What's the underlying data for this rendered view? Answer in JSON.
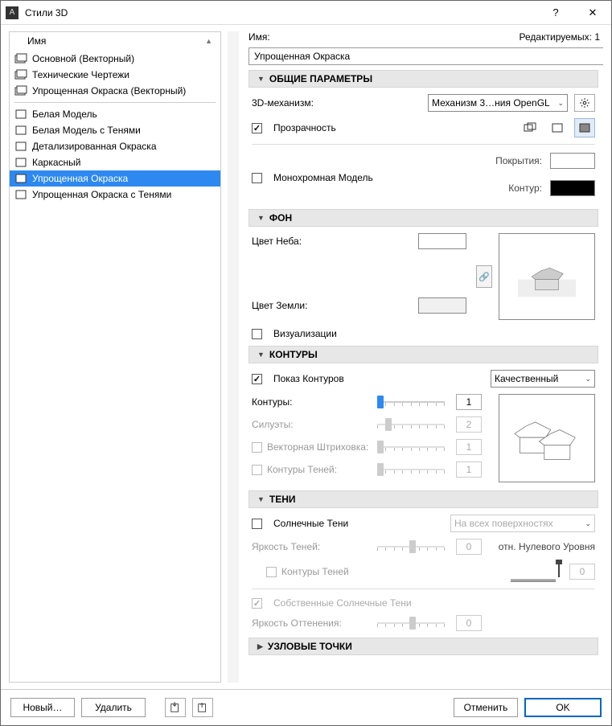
{
  "window": {
    "title": "Стили 3D"
  },
  "left": {
    "header": "Имя",
    "groups": [
      {
        "items": [
          {
            "label": "Основной (Векторный)"
          },
          {
            "label": "Технические Чертежи"
          },
          {
            "label": "Упрощенная Окраска (Векторный)"
          }
        ]
      },
      {
        "items": [
          {
            "label": "Белая Модель"
          },
          {
            "label": "Белая Модель с Тенями"
          },
          {
            "label": "Детализированная Окраска"
          },
          {
            "label": "Каркасный"
          },
          {
            "label": "Упрощенная Окраска",
            "selected": true
          },
          {
            "label": "Упрощенная Окраска с Тенями"
          }
        ]
      }
    ]
  },
  "right": {
    "name_label": "Имя:",
    "editable_label": "Редактируемых: 1",
    "name_value": "Упрощенная Окраска",
    "sec_general": "ОБЩИЕ ПАРАМЕТРЫ",
    "mech_label": "3D-механизм:",
    "mech_value": "Механизм 3…ния OpenGL",
    "transp": "Прозрачность",
    "mono": "Монохромная Модель",
    "cover": "Покрытия:",
    "contour_lbl": "Контур:",
    "sec_bg": "ФОН",
    "sky": "Цвет Неба:",
    "ground": "Цвет Земли:",
    "visual": "Визуализации",
    "sec_ct": "КОНТУРЫ",
    "show_ct": "Показ Контуров",
    "quality": "Качественный",
    "ct_k": "Контуры:",
    "ct_s": "Силуэты:",
    "ct_v": "Векторная Штриховка:",
    "ct_sh": "Контуры Теней:",
    "ct_k_v": "1",
    "ct_s_v": "2",
    "ct_v_v": "1",
    "ct_sh_v": "1",
    "sec_sh": "ТЕНИ",
    "sun": "Солнечные Тени",
    "surfaces": "На всех поверхностях",
    "sb": "Яркость Теней:",
    "sb_v": "0",
    "zero": "отн. Нулевого Уровня",
    "sh_ct": "Контуры Теней",
    "sh_ct_v": "0",
    "self": "Собственные Солнечные Тени",
    "tint": "Яркость Оттенения:",
    "tint_v": "0",
    "sec_nodes": "УЗЛОВЫЕ ТОЧКИ"
  },
  "footer": {
    "new_btn": "Новый…",
    "del_btn": "Удалить",
    "cancel": "Отменить",
    "ok": "OK"
  }
}
